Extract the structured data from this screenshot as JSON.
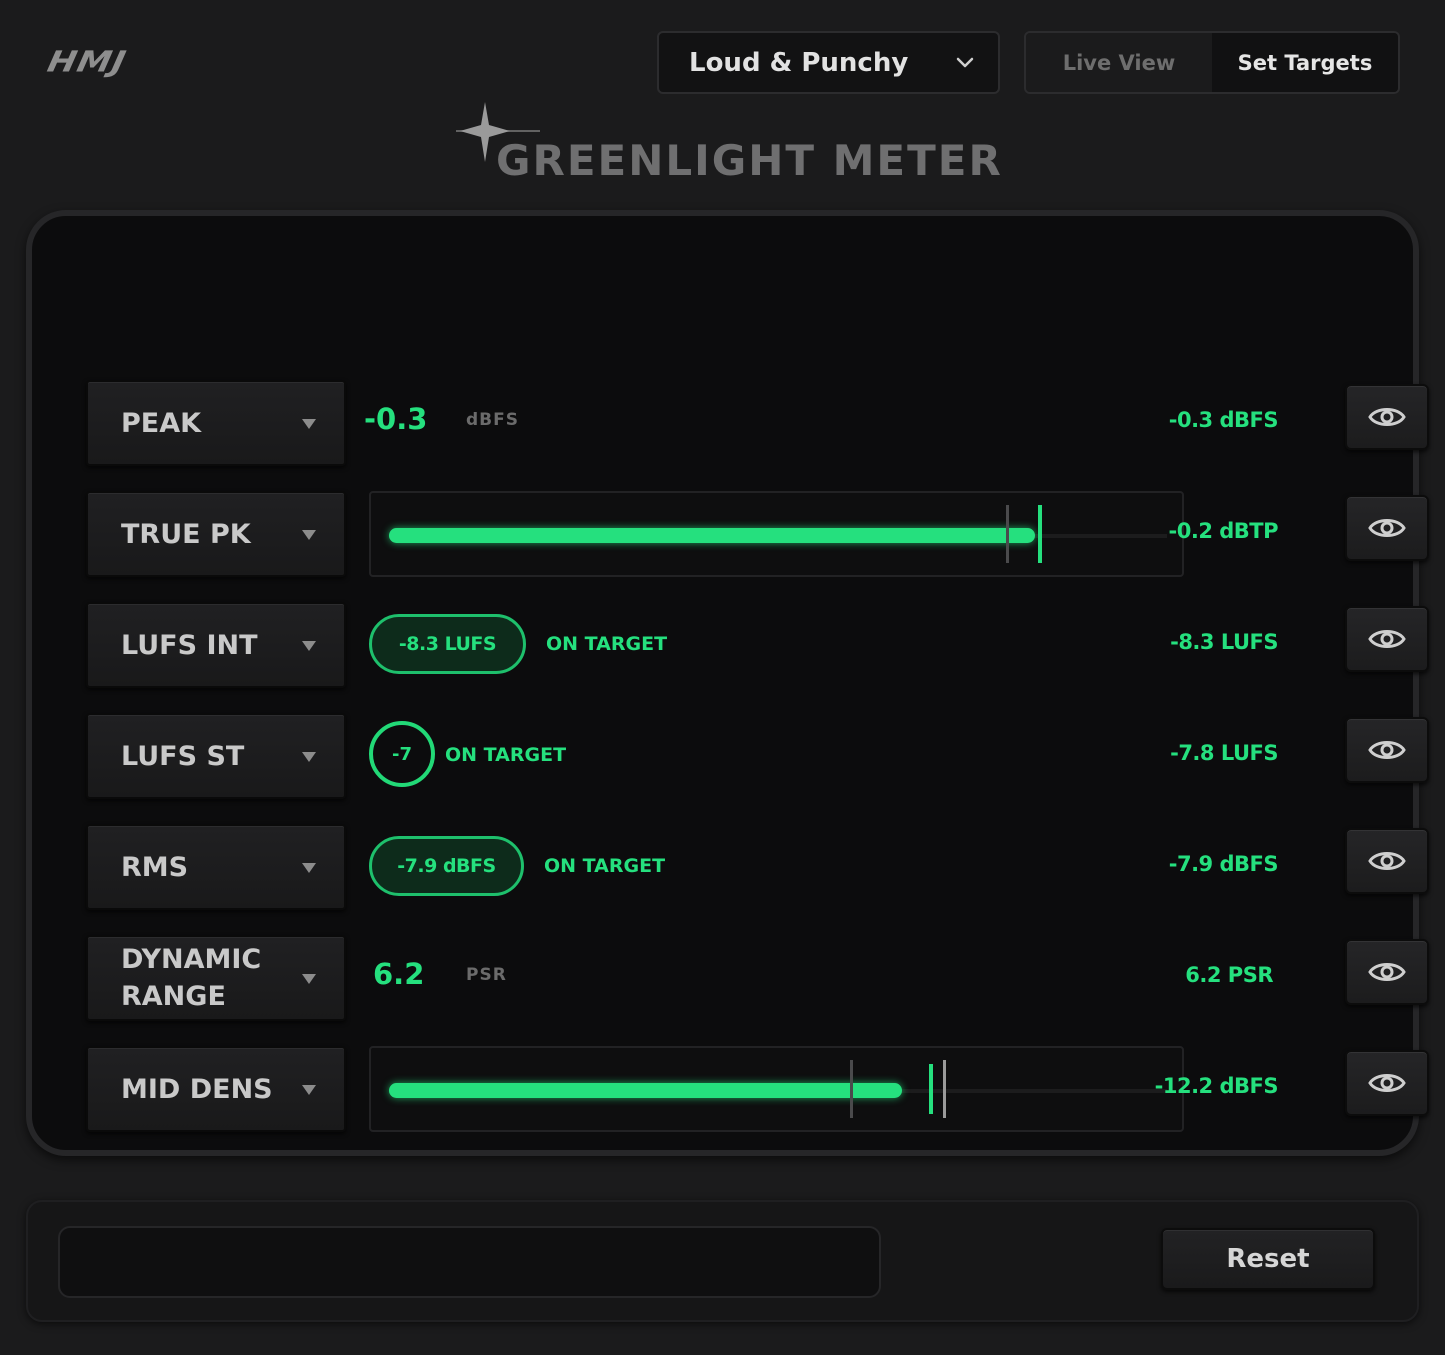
{
  "header": {
    "logo": "HMJ",
    "preset": {
      "value": "Loud & Punchy",
      "icon": "chevron-down-icon"
    },
    "view_tabs": [
      {
        "label": "Live View",
        "active": false
      },
      {
        "label": "Set Targets",
        "active": true
      }
    ],
    "title": "GREENLIGHT METER"
  },
  "colors": {
    "accent": "#25e07e",
    "background": "#1b1b1c",
    "panel": "#0c0c0d",
    "muted": "#6b6b6b"
  },
  "meters": [
    {
      "label": "PEAK",
      "value": "-0.3",
      "unit": "dBFS",
      "readout": "-0.3 dBFS",
      "icon": "eye-icon"
    },
    {
      "label": "TRUE PK",
      "fill_fraction": 0.83,
      "readout": "-0.2 dBTP",
      "icon": "eye-icon"
    },
    {
      "label": "LUFS INT",
      "pill": "-8.3 LUFS",
      "status": "ON TARGET",
      "readout": "-8.3 LUFS",
      "icon": "eye-icon"
    },
    {
      "label": "LUFS ST",
      "badge": "-7",
      "status": "ON TARGET",
      "readout": "-7.8 LUFS",
      "icon": "eye-icon"
    },
    {
      "label": "RMS",
      "pill": "-7.9 dBFS",
      "status": "ON TARGET",
      "readout": "-7.9 dBFS",
      "icon": "eye-icon"
    },
    {
      "label": "DYNAMIC RANGE",
      "value": "6.2",
      "unit": "PSR",
      "readout": "6.2 PSR",
      "icon": "eye-icon"
    },
    {
      "label": "MID DENS",
      "fill_fraction": 0.66,
      "readout": "-12.2 dBFS",
      "icon": "eye-icon"
    }
  ],
  "footer": {
    "message": "",
    "reset_label": "Reset"
  }
}
